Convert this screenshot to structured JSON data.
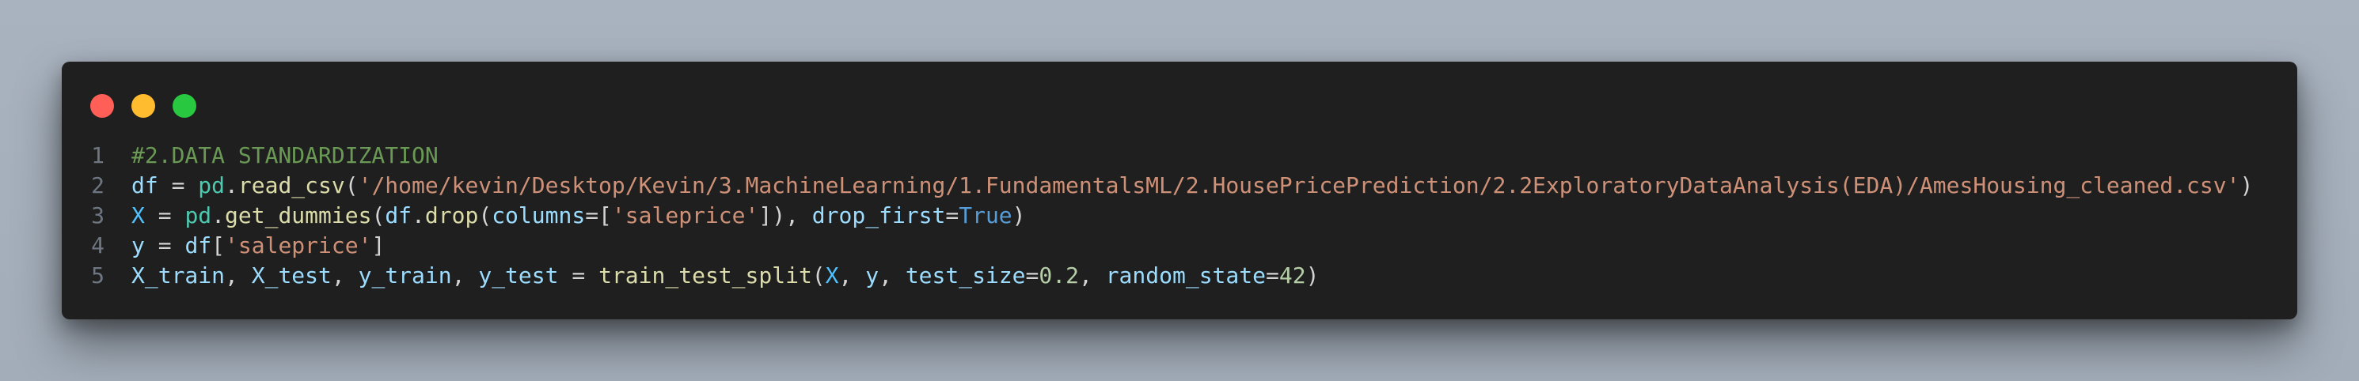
{
  "window": {
    "controls": [
      "close",
      "minimize",
      "maximize"
    ]
  },
  "code": {
    "colors": {
      "comment": "#6a9955",
      "variable": "#9cdcfe",
      "module": "#4ec9b0",
      "function": "#dcdcaa",
      "string": "#ce9178",
      "keyword_const": "#569cd6",
      "number": "#b5cea8",
      "plain": "#d4d4d4",
      "constant": "#4fc1ff"
    },
    "lines": [
      {
        "number": "1",
        "tokens": [
          {
            "t": "#2.DATA STANDARDIZATION",
            "c": "comment"
          }
        ]
      },
      {
        "number": "2",
        "tokens": [
          {
            "t": "df",
            "c": "variable"
          },
          {
            "t": " = ",
            "c": "plain"
          },
          {
            "t": "pd",
            "c": "module"
          },
          {
            "t": ".",
            "c": "plain"
          },
          {
            "t": "read_csv",
            "c": "function"
          },
          {
            "t": "(",
            "c": "plain"
          },
          {
            "t": "'/home/kevin/Desktop/Kevin/3.MachineLearning/1.FundamentalsML/2.HousePricePrediction/2.2ExploratoryDataAnalysis(EDA)/AmesHousing_cleaned.csv'",
            "c": "string"
          },
          {
            "t": ")",
            "c": "plain"
          }
        ]
      },
      {
        "number": "3",
        "tokens": [
          {
            "t": "X",
            "c": "constant"
          },
          {
            "t": " = ",
            "c": "plain"
          },
          {
            "t": "pd",
            "c": "module"
          },
          {
            "t": ".",
            "c": "plain"
          },
          {
            "t": "get_dummies",
            "c": "function"
          },
          {
            "t": "(",
            "c": "plain"
          },
          {
            "t": "df",
            "c": "variable"
          },
          {
            "t": ".",
            "c": "plain"
          },
          {
            "t": "drop",
            "c": "function"
          },
          {
            "t": "(",
            "c": "plain"
          },
          {
            "t": "columns",
            "c": "variable"
          },
          {
            "t": "=[",
            "c": "plain"
          },
          {
            "t": "'saleprice'",
            "c": "string"
          },
          {
            "t": "]), ",
            "c": "plain"
          },
          {
            "t": "drop_first",
            "c": "variable"
          },
          {
            "t": "=",
            "c": "plain"
          },
          {
            "t": "True",
            "c": "keyword_const"
          },
          {
            "t": ")",
            "c": "plain"
          }
        ]
      },
      {
        "number": "4",
        "tokens": [
          {
            "t": "y",
            "c": "variable"
          },
          {
            "t": " = ",
            "c": "plain"
          },
          {
            "t": "df",
            "c": "variable"
          },
          {
            "t": "[",
            "c": "plain"
          },
          {
            "t": "'saleprice'",
            "c": "string"
          },
          {
            "t": "]",
            "c": "plain"
          }
        ]
      },
      {
        "number": "5",
        "tokens": [
          {
            "t": "X_train",
            "c": "variable"
          },
          {
            "t": ", ",
            "c": "plain"
          },
          {
            "t": "X_test",
            "c": "variable"
          },
          {
            "t": ", ",
            "c": "plain"
          },
          {
            "t": "y_train",
            "c": "variable"
          },
          {
            "t": ", ",
            "c": "plain"
          },
          {
            "t": "y_test",
            "c": "variable"
          },
          {
            "t": " = ",
            "c": "plain"
          },
          {
            "t": "train_test_split",
            "c": "function"
          },
          {
            "t": "(",
            "c": "plain"
          },
          {
            "t": "X",
            "c": "constant"
          },
          {
            "t": ", ",
            "c": "plain"
          },
          {
            "t": "y",
            "c": "variable"
          },
          {
            "t": ", ",
            "c": "plain"
          },
          {
            "t": "test_size",
            "c": "variable"
          },
          {
            "t": "=",
            "c": "plain"
          },
          {
            "t": "0.2",
            "c": "number"
          },
          {
            "t": ", ",
            "c": "plain"
          },
          {
            "t": "random_state",
            "c": "variable"
          },
          {
            "t": "=",
            "c": "plain"
          },
          {
            "t": "42",
            "c": "number"
          },
          {
            "t": ")",
            "c": "plain"
          }
        ]
      }
    ]
  }
}
